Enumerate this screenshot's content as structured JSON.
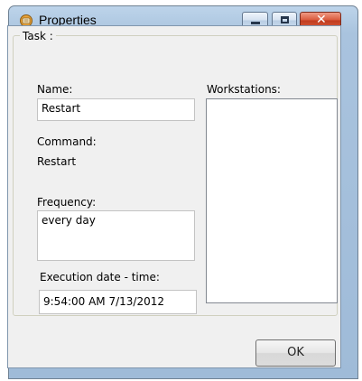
{
  "window": {
    "title": "Properties",
    "close_glyph": "✕"
  },
  "task_group": {
    "label": "Task :"
  },
  "fields": {
    "name_label": "Name:",
    "name_value": "Restart",
    "command_label": "Command:",
    "command_value": "Restart",
    "frequency_label": "Frequency:",
    "frequency_value": "every day",
    "execution_label": "Execution date - time:",
    "execution_value": "9:54:00 AM 7/13/2012",
    "workstations_label": "Workstations:"
  },
  "buttons": {
    "ok_label": "OK"
  },
  "icons": {
    "app": "properties-app-icon",
    "minimize": "minimize-icon",
    "maximize": "maximize-icon",
    "close": "close-icon"
  },
  "colors": {
    "titlebar": "#a9c3de",
    "close_button": "#c9452a",
    "client_bg": "#f0f0f0"
  }
}
